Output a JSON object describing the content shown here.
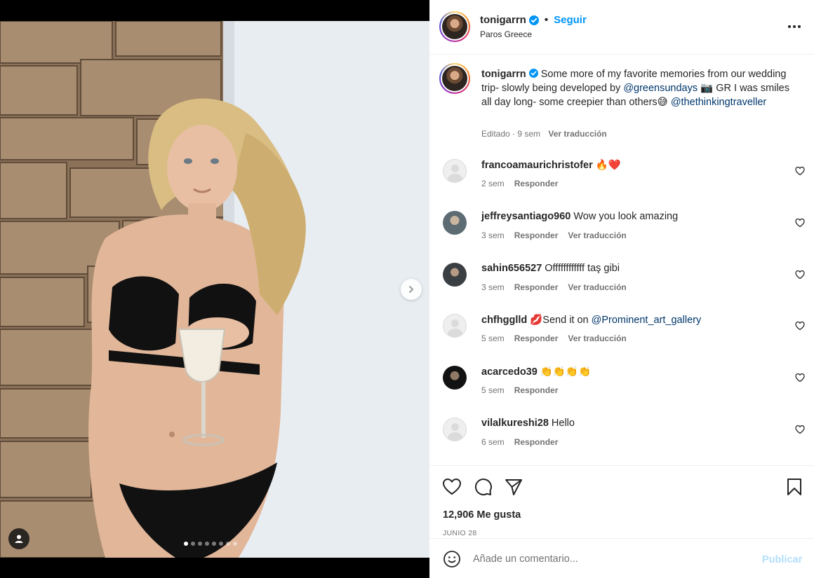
{
  "post": {
    "username": "tonigarrn",
    "follow_label": "Seguir",
    "location": "Paros Greece",
    "separator": "•"
  },
  "media": {
    "slide_count": 8,
    "active_slide": 1
  },
  "caption": {
    "username": "tonigarrn",
    "text_1": "Some more of my favorite memories from our wedding trip- slowly being developed by",
    "mention_1": "@greensundays",
    "text_2": "📷 GR I was smiles all day long- some creepier than others😅",
    "mention_2": "@thethinkingtraveller",
    "meta_time": "Editado · 9 sem",
    "meta_translate": "Ver traducción"
  },
  "comments": [
    {
      "username": "francoamaurichristofer",
      "text": "🔥❤️",
      "time": "2 sem",
      "reply": "Responder",
      "translate": ""
    },
    {
      "username": "jeffreysantiago960",
      "text": "Wow you look amazing",
      "time": "3 sem",
      "reply": "Responder",
      "translate": "Ver traducción"
    },
    {
      "username": "sahin656527",
      "text": "Offffffffffff taş gibi",
      "time": "3 sem",
      "reply": "Responder",
      "translate": "Ver traducción"
    },
    {
      "username": "chfhgglld",
      "text_pre": "💋Send it on ",
      "mention": "@Prominent_art_gallery",
      "time": "5 sem",
      "reply": "Responder",
      "translate": "Ver traducción"
    },
    {
      "username": "acarcedo39",
      "text": "👏👏👏👏",
      "time": "5 sem",
      "reply": "Responder",
      "translate": ""
    },
    {
      "username": "vilalkureshi28",
      "text": "Hello",
      "time": "6 sem",
      "reply": "Responder",
      "translate": ""
    }
  ],
  "stats": {
    "likes": "12,906 Me gusta",
    "date": "JUNIO 28"
  },
  "compose": {
    "placeholder": "Añade un comentario...",
    "publish_label": "Publicar"
  },
  "colors": {
    "accent": "#0095f6",
    "mention": "#00376b",
    "muted": "#737373",
    "publish_disabled": "#b2dffc"
  }
}
